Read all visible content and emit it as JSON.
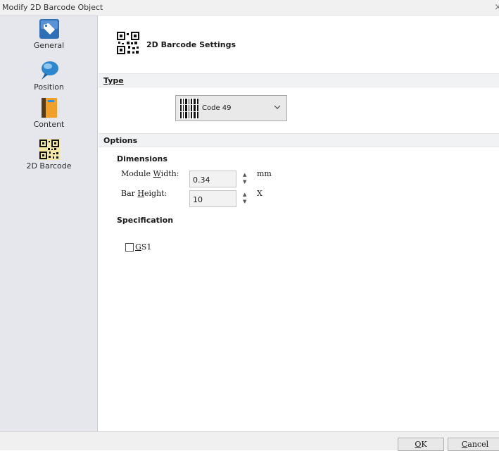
{
  "window": {
    "title": "Modify 2D Barcode Object",
    "close_glyph": "×"
  },
  "sidebar": {
    "items": [
      {
        "label": "General",
        "icon": "tag-icon"
      },
      {
        "label": "Position",
        "icon": "pin-icon"
      },
      {
        "label": "Content",
        "icon": "book-icon"
      },
      {
        "label": "2D Barcode",
        "icon": "qr-code-icon"
      }
    ]
  },
  "header": {
    "title": "2D Barcode Settings",
    "icon": "qr-code-icon"
  },
  "type_section": {
    "label": "Type",
    "combo_value": "Code 49",
    "combo_icon": "barcode-icon"
  },
  "options_section": {
    "label": "Options",
    "dimensions": {
      "heading": "Dimensions",
      "module_width": {
        "label_pre": "Module ",
        "label_key": "W",
        "label_post": "idth:",
        "value": "0.34",
        "unit": "mm"
      },
      "bar_height": {
        "label_pre": "Bar ",
        "label_key": "H",
        "label_post": "eight:",
        "value": "10",
        "unit": "X"
      }
    },
    "specification": {
      "heading": "Specification",
      "gs1": {
        "label_key": "G",
        "label_post": "S1",
        "checked": false
      }
    }
  },
  "footer": {
    "ok": {
      "key": "O",
      "rest": "K"
    },
    "cancel": {
      "key": "C",
      "rest": "ancel"
    }
  },
  "colors": {
    "sidebar_bg": "#e5e7ec",
    "section_bg": "#f1f2f4",
    "accent_blue": "#2e6fb5",
    "book_orange": "#f0a02a"
  }
}
